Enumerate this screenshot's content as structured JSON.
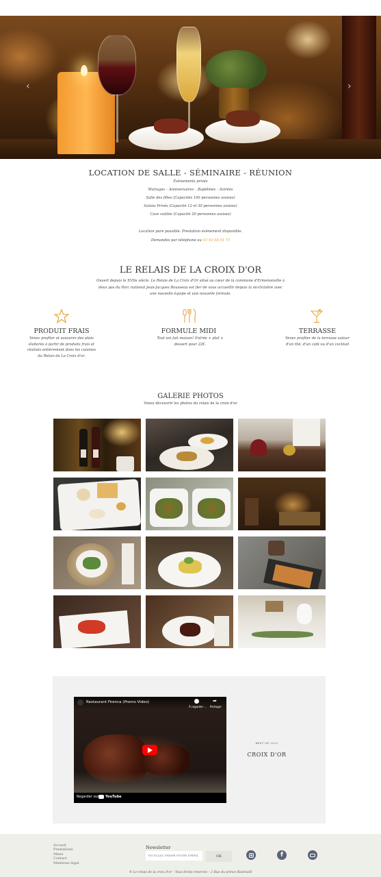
{
  "hero": {
    "prev_arrow": "‹",
    "next_arrow": "›"
  },
  "location": {
    "title": "LOCATION DE SALLE - SÉMINAIRE - RÉUNION",
    "lines": [
      "Évènements privés",
      "Mariages – Anniversaires – Baptêmes – Soirées",
      "Salle des fêtes (Capacités 100 personnes assises)",
      "Salons Privés (Capacité 12 et 30 personnes assises)",
      "Cave voûtée (Capacité 20 personnes assises)"
    ],
    "extra": "Location pure possible. Prestation évènement disponible.",
    "phone_prefix": "Demandes par téléphone au",
    "phone": "03 44 58 04 75"
  },
  "about": {
    "title": "LE RELAIS DE LA CROIX D'OR",
    "text": "Ouvert depuis le XVIIe siècle, Le Relais de La Croix d'Or situé au cœur de la commune d'Ermenonville à deux pas du Parc national Jean-Jacques Rousseau est fier de vous accueillir depuis la mi-Octobre avec une nouvelle équipe et une nouvelle formule."
  },
  "features": [
    {
      "icon": "star-icon",
      "title": "PRODUIT FRAIS",
      "text": "Venez profiter et savourer des plats élaborés à partir de produits frais et réalisés entièrement dans les cuisines du Relais de La Croix d'or."
    },
    {
      "icon": "cutlery-icon",
      "title": "FORMULE MIDI",
      "text": "Tout est fait maison! Entrée + plat + dessert pour 22€."
    },
    {
      "icon": "cocktail-icon",
      "title": "TERRASSE",
      "text": "Venez profiter de la terrasse autour d'un thé, d'un café ou d'un cocktail"
    }
  ],
  "gallery": {
    "title": "GALERIE PHOTOS",
    "subtitle": "Venez découvrir les photos du relais de la croix d'or",
    "photos": [
      "wine-bottles-photo",
      "dish-plating-photo",
      "dining-room-photo",
      "plated-dessert-photo",
      "salad-boats-photo",
      "restaurant-interior-photo",
      "green-salad-photo",
      "fish-dish-photo",
      "tart-dish-photo",
      "carpaccio-photo",
      "meat-dish-photo",
      "table-setting-photo"
    ]
  },
  "video": {
    "title": "Restaurant Firenca (Promo Video)",
    "watch_later": "À regarder ...",
    "share": "Partager",
    "watch_on": "Regarder sur",
    "youtube": "YouTube"
  },
  "award": {
    "label": "BEST OF 2022",
    "name": "CROIX D'OR"
  },
  "footer": {
    "links": [
      "Accueil",
      "Prestations",
      "Menu",
      "Contact",
      "Mentions légal"
    ],
    "newsletter_title": "Newsletter",
    "email_placeholder": "VEUILLEZ SAISIR VOTRE EMAIL",
    "ok_label": "OK",
    "social": [
      "instagram-icon",
      "facebook-icon",
      "youtube-icon"
    ],
    "copyright": "© Le relais de la croix d'or - Tous droits réservés – 2 Rue du prince Radziwill"
  }
}
